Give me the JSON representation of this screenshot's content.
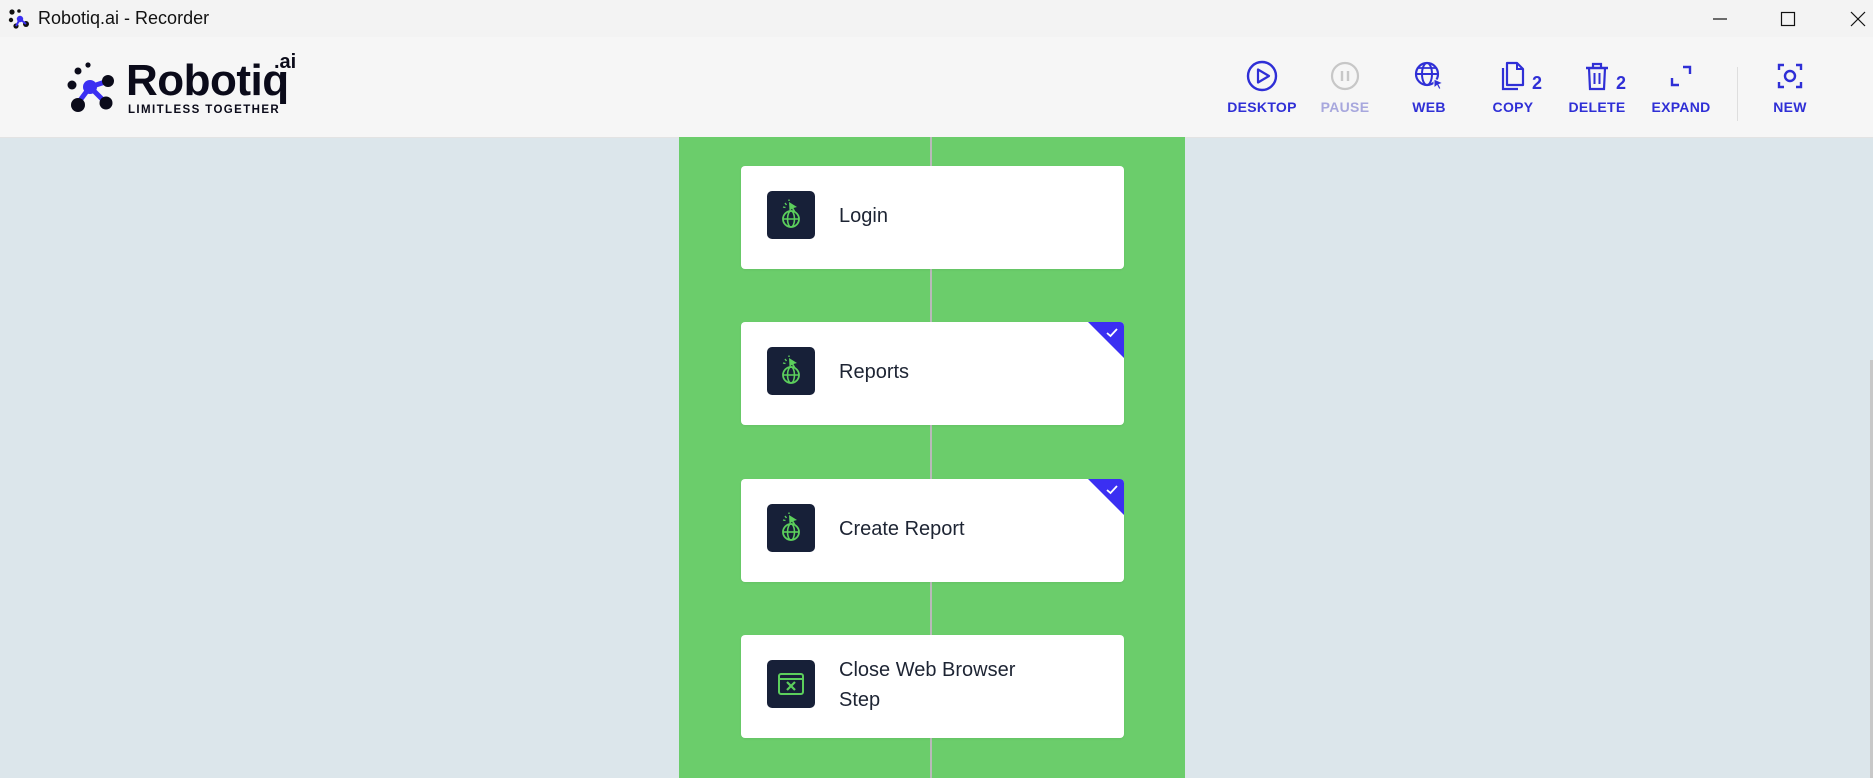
{
  "window": {
    "title": "Robotiq.ai - Recorder",
    "minimize_icon": "minimize-icon",
    "maximize_icon": "maximize-icon",
    "close_icon": "close-icon"
  },
  "logo": {
    "wordmark": "Robotiq",
    "superscript": ".ai",
    "tagline": "LIMITLESS TOGETHER"
  },
  "toolbar": [
    {
      "id": "desktop",
      "label": "DESKTOP",
      "icon": "play-circle-icon",
      "enabled": true
    },
    {
      "id": "pause",
      "label": "PAUSE",
      "icon": "pause-circle-icon",
      "enabled": false
    },
    {
      "id": "web",
      "label": "WEB",
      "icon": "globe-cursor-icon",
      "enabled": true
    },
    {
      "id": "copy",
      "label": "COPY",
      "icon": "copy-icon",
      "count": "2",
      "enabled": true
    },
    {
      "id": "delete",
      "label": "DELETE",
      "icon": "trash-icon",
      "count": "2",
      "enabled": true
    },
    {
      "id": "expand",
      "label": "EXPAND",
      "icon": "expand-icon",
      "enabled": true
    },
    {
      "id": "new",
      "label": "NEW",
      "icon": "new-capture-icon",
      "enabled": true
    }
  ],
  "steps": [
    {
      "label": "Login",
      "icon": "web-click-icon",
      "selected": false
    },
    {
      "label": "Reports",
      "icon": "web-click-icon",
      "selected": true
    },
    {
      "label": "Create Report",
      "icon": "web-click-icon",
      "selected": true
    },
    {
      "label": "Close Web Browser Step",
      "icon": "close-browser-icon",
      "selected": false
    }
  ],
  "colors": {
    "accent": "#2f2fd6",
    "flow_background": "#6bcd6b",
    "canvas_background": "#dce6eb",
    "step_icon_background": "#172038",
    "selected_corner": "#3b2ff2"
  }
}
